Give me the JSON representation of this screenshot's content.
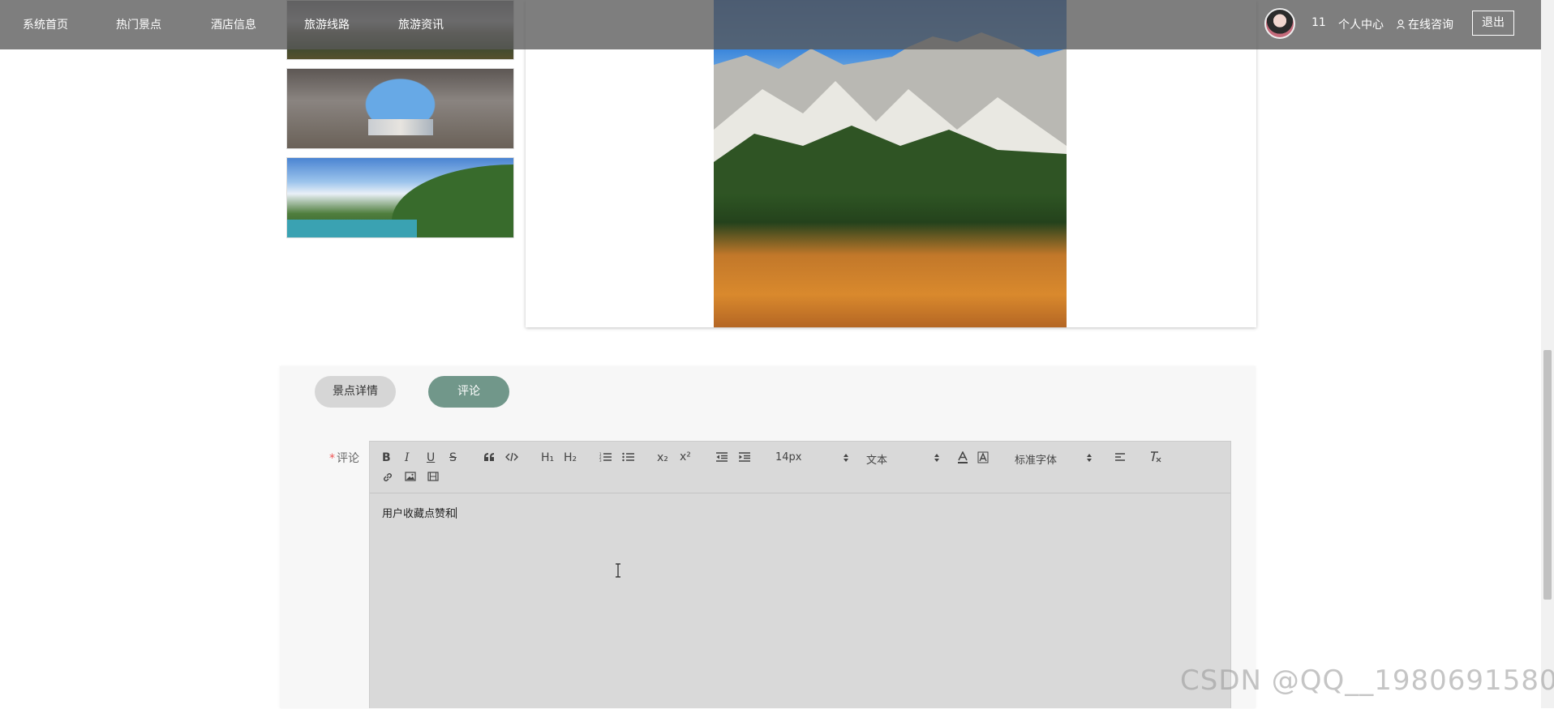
{
  "nav": {
    "items": [
      {
        "label": "系统首页"
      },
      {
        "label": "热门景点"
      },
      {
        "label": "酒店信息"
      },
      {
        "label": "旅游线路"
      },
      {
        "label": "旅游资讯"
      }
    ],
    "user_id": "11",
    "user_center": "个人中心",
    "consult": "在线咨询",
    "logout": "退出"
  },
  "tabs": [
    {
      "label": "景点详情",
      "active": false
    },
    {
      "label": "评论",
      "active": true
    }
  ],
  "comment": {
    "required_mark": "*",
    "label": "评论",
    "content": "用户收藏点赞和"
  },
  "toolbar": {
    "font_size": "14px",
    "heading_type": "文本",
    "font_family": "标准字体",
    "subscript_label": "x₂",
    "superscript_label": "x²",
    "h1_label": "H₁",
    "h2_label": "H₂"
  },
  "watermark": "CSDN @QQ__1980691580",
  "colors": {
    "active_tab": "#71978a",
    "nav_bg": "rgba(90,90,90,0.78)",
    "required": "#ee5555"
  }
}
